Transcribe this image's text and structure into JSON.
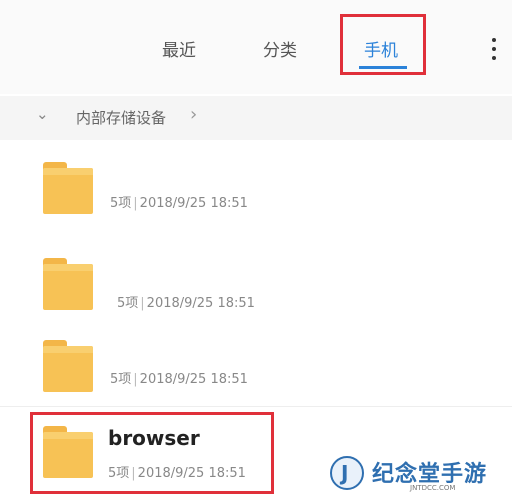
{
  "tabs": [
    {
      "label": "最近"
    },
    {
      "label": "分类"
    },
    {
      "label": "手机"
    }
  ],
  "breadcrumb": {
    "label": "内部存储设备",
    "chevron": "chevron-down-icon",
    "arrow": "chevron-right-icon",
    "arrow_glyph": "›",
    "chevron_glyph": "⌄"
  },
  "folders": [
    {
      "name": "",
      "count": "5项",
      "date": "2018/9/25 18:51"
    },
    {
      "name": "",
      "count": "5项",
      "date": "2018/9/25 18:51"
    },
    {
      "name": "",
      "count": "5项",
      "date": "2018/9/25 18:51"
    },
    {
      "name": "browser",
      "count": "5项",
      "date": "2018/9/25 18:51"
    }
  ],
  "separator": "|",
  "colors": {
    "accent": "#2b82d9",
    "highlight": "#e0303a",
    "folder": "#f7c255"
  },
  "watermark": {
    "text": "纪念堂手游",
    "logo_letter": "J",
    "subtext": "JNTDCC.COM"
  }
}
